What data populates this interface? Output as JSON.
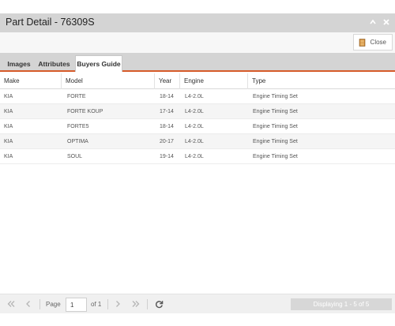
{
  "window": {
    "title": "Part Detail - 76309S",
    "tools": [
      "collapse-icon",
      "close-icon"
    ]
  },
  "toolbar": {
    "close_label": "Close"
  },
  "tabs": [
    {
      "label": "Images",
      "active": false
    },
    {
      "label": "Attributes",
      "active": false
    },
    {
      "label": "Buyers Guide",
      "active": true
    }
  ],
  "grid": {
    "columns": [
      "Make",
      "Model",
      "Year",
      "Engine",
      "Type"
    ],
    "rows": [
      {
        "make": "KIA",
        "model": "FORTE",
        "year": "18-14",
        "engine": "L4-2.0L",
        "type": "Engine Timing Set"
      },
      {
        "make": "KIA",
        "model": "FORTE KOUP",
        "year": "17-14",
        "engine": "L4-2.0L",
        "type": "Engine Timing Set"
      },
      {
        "make": "KIA",
        "model": "FORTE5",
        "year": "18-14",
        "engine": "L4-2.0L",
        "type": "Engine Timing Set"
      },
      {
        "make": "KIA",
        "model": "OPTIMA",
        "year": "20-17",
        "engine": "L4-2.0L",
        "type": "Engine Timing Set"
      },
      {
        "make": "KIA",
        "model": "SOUL",
        "year": "19-14",
        "engine": "L4-2.0L",
        "type": "Engine Timing Set"
      }
    ]
  },
  "pager": {
    "page_label": "Page",
    "page_value": "1",
    "of_label": "of 1",
    "display_text": "Displaying 1 - 5 of 5"
  },
  "colors": {
    "accent": "#d75b2a",
    "titlebar": "#d4d4d4"
  }
}
